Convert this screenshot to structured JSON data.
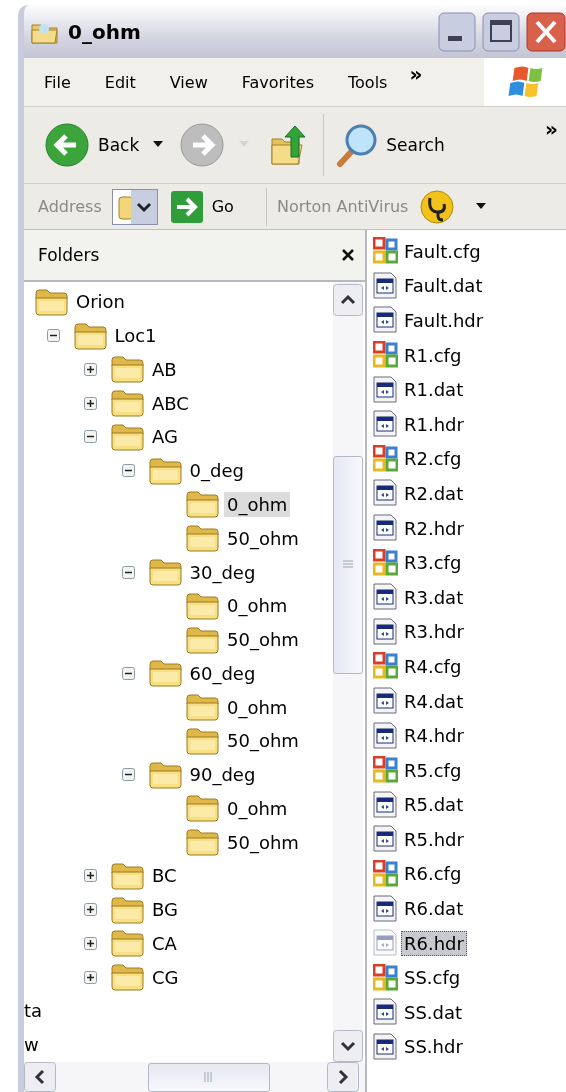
{
  "window": {
    "title": "0_ohm"
  },
  "menu": [
    {
      "label": "File"
    },
    {
      "label": "Edit"
    },
    {
      "label": "View"
    },
    {
      "label": "Favorites"
    },
    {
      "label": "Tools"
    }
  ],
  "menu_overflow": "»",
  "toolbar": {
    "back": {
      "label": "Back",
      "disabled": false
    },
    "forward": {
      "disabled": true
    },
    "search": {
      "label": "Search"
    },
    "overflow": "»"
  },
  "address_bar": {
    "label": "Address",
    "go": "Go",
    "norton": "Norton AntiVirus"
  },
  "folders_pane": {
    "title": "Folders",
    "tree": [
      {
        "label": "Orion",
        "toggle": false,
        "expanded": true,
        "selected": false,
        "children": [
          {
            "label": "Loc1",
            "toggle": true,
            "expanded": true,
            "selected": false,
            "children": [
              {
                "label": "AB",
                "toggle": true,
                "expanded": false,
                "selected": false
              },
              {
                "label": "ABC",
                "toggle": true,
                "expanded": false,
                "selected": false
              },
              {
                "label": "AG",
                "toggle": true,
                "expanded": true,
                "selected": false,
                "children": [
                  {
                    "label": "0_deg",
                    "toggle": true,
                    "expanded": true,
                    "selected": false,
                    "children": [
                      {
                        "label": "0_ohm",
                        "toggle": false,
                        "expanded": false,
                        "selected": true
                      },
                      {
                        "label": "50_ohm",
                        "toggle": false,
                        "expanded": false,
                        "selected": false
                      }
                    ]
                  },
                  {
                    "label": "30_deg",
                    "toggle": true,
                    "expanded": true,
                    "selected": false,
                    "children": [
                      {
                        "label": "0_ohm",
                        "toggle": false,
                        "expanded": false,
                        "selected": false
                      },
                      {
                        "label": "50_ohm",
                        "toggle": false,
                        "expanded": false,
                        "selected": false
                      }
                    ]
                  },
                  {
                    "label": "60_deg",
                    "toggle": true,
                    "expanded": true,
                    "selected": false,
                    "children": [
                      {
                        "label": "0_ohm",
                        "toggle": false,
                        "expanded": false,
                        "selected": false
                      },
                      {
                        "label": "50_ohm",
                        "toggle": false,
                        "expanded": false,
                        "selected": false
                      }
                    ]
                  },
                  {
                    "label": "90_deg",
                    "toggle": true,
                    "expanded": true,
                    "selected": false,
                    "children": [
                      {
                        "label": "0_ohm",
                        "toggle": false,
                        "expanded": false,
                        "selected": false
                      },
                      {
                        "label": "50_ohm",
                        "toggle": false,
                        "expanded": false,
                        "selected": false
                      }
                    ]
                  }
                ]
              },
              {
                "label": "BC",
                "toggle": true,
                "expanded": false,
                "selected": false
              },
              {
                "label": "BG",
                "toggle": true,
                "expanded": false,
                "selected": false
              },
              {
                "label": "CA",
                "toggle": true,
                "expanded": false,
                "selected": false
              },
              {
                "label": "CG",
                "toggle": true,
                "expanded": false,
                "selected": false
              }
            ]
          }
        ]
      }
    ],
    "fragments": [
      "ta",
      "w"
    ]
  },
  "files": [
    {
      "name": "Fault.cfg",
      "kind": "config",
      "selected": false
    },
    {
      "name": "Fault.dat",
      "kind": "data",
      "selected": false
    },
    {
      "name": "Fault.hdr",
      "kind": "data",
      "selected": false
    },
    {
      "name": "R1.cfg",
      "kind": "config",
      "selected": false
    },
    {
      "name": "R1.dat",
      "kind": "data",
      "selected": false
    },
    {
      "name": "R1.hdr",
      "kind": "data",
      "selected": false
    },
    {
      "name": "R2.cfg",
      "kind": "config",
      "selected": false
    },
    {
      "name": "R2.dat",
      "kind": "data",
      "selected": false
    },
    {
      "name": "R2.hdr",
      "kind": "data",
      "selected": false
    },
    {
      "name": "R3.cfg",
      "kind": "config",
      "selected": false
    },
    {
      "name": "R3.dat",
      "kind": "data",
      "selected": false
    },
    {
      "name": "R3.hdr",
      "kind": "data",
      "selected": false
    },
    {
      "name": "R4.cfg",
      "kind": "config",
      "selected": false
    },
    {
      "name": "R4.dat",
      "kind": "data",
      "selected": false
    },
    {
      "name": "R4.hdr",
      "kind": "data",
      "selected": false
    },
    {
      "name": "R5.cfg",
      "kind": "config",
      "selected": false
    },
    {
      "name": "R5.dat",
      "kind": "data",
      "selected": false
    },
    {
      "name": "R5.hdr",
      "kind": "data",
      "selected": false
    },
    {
      "name": "R6.cfg",
      "kind": "config",
      "selected": false
    },
    {
      "name": "R6.dat",
      "kind": "data",
      "selected": false
    },
    {
      "name": "R6.hdr",
      "kind": "data",
      "selected": true
    },
    {
      "name": "SS.cfg",
      "kind": "config",
      "selected": false
    },
    {
      "name": "SS.dat",
      "kind": "data",
      "selected": false
    },
    {
      "name": "SS.hdr",
      "kind": "data",
      "selected": false
    }
  ]
}
